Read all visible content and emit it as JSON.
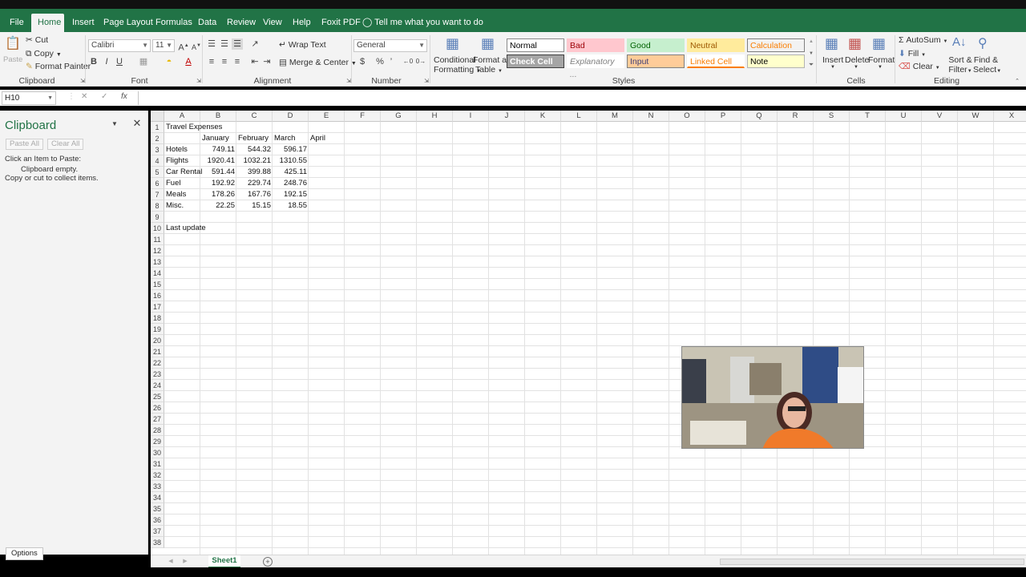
{
  "tabs": [
    "File",
    "Home",
    "Insert",
    "Page Layout",
    "Formulas",
    "Data",
    "Review",
    "View",
    "Help",
    "Foxit PDF"
  ],
  "tell_me": "Tell me what you want to do",
  "ribbon": {
    "clipboard": {
      "paste": "Paste",
      "cut": "Cut",
      "copy": "Copy",
      "format_painter": "Format Painter",
      "label": "Clipboard"
    },
    "font": {
      "name": "Calibri",
      "size": "11",
      "bold": "B",
      "italic": "I",
      "underline": "U",
      "label": "Font"
    },
    "alignment": {
      "wrap": "Wrap Text",
      "merge": "Merge & Center",
      "label": "Alignment"
    },
    "number": {
      "format": "General",
      "currency": "$",
      "percent": "%",
      "comma": "’",
      "label": "Number"
    },
    "conditional": [
      "Conditional",
      "Formatting"
    ],
    "format_table": [
      "Format as",
      "Table"
    ],
    "styles": {
      "label": "Styles",
      "items": [
        {
          "name": "Normal",
          "bg": "#ffffff",
          "fg": "#000000",
          "border": "#8a8a8a"
        },
        {
          "name": "Bad",
          "bg": "#ffc7ce",
          "fg": "#9c0006",
          "border": "#ffc7ce"
        },
        {
          "name": "Good",
          "bg": "#c6efce",
          "fg": "#006100",
          "border": "#c6efce"
        },
        {
          "name": "Neutral",
          "bg": "#ffeb9c",
          "fg": "#9c5700",
          "border": "#ffeb9c"
        },
        {
          "name": "Calculation",
          "bg": "#f2f2f2",
          "fg": "#fa7d00",
          "border": "#7f7f7f"
        },
        {
          "name": "Check Cell",
          "bg": "#a5a5a5",
          "fg": "#ffffff",
          "border": "#3f3f3f"
        },
        {
          "name": "Explanatory ...",
          "bg": "#ffffff",
          "fg": "#7f7f7f",
          "border": "#ffffff"
        },
        {
          "name": "Input",
          "bg": "#ffcc99",
          "fg": "#3f3f76",
          "border": "#7f7f7f"
        },
        {
          "name": "Linked Cell",
          "bg": "#ffffff",
          "fg": "#fa7d00",
          "border": "#ffffff"
        },
        {
          "name": "Note",
          "bg": "#ffffcc",
          "fg": "#000000",
          "border": "#b2b2b2"
        }
      ]
    },
    "cells": {
      "insert": "Insert",
      "delete": "Delete",
      "format": "Format",
      "label": "Cells"
    },
    "editing": {
      "autosum": "AutoSum",
      "fill": "Fill",
      "clear": "Clear",
      "sort": [
        "Sort &",
        "Filter"
      ],
      "find": [
        "Find &",
        "Select"
      ],
      "label": "Editing"
    }
  },
  "formula_bar": {
    "name_box": "H10",
    "fx": "fx",
    "value": ""
  },
  "clipboard_pane": {
    "title": "Clipboard",
    "paste_all": "Paste All",
    "clear_all": "Clear All",
    "instruction": "Click an Item to Paste:",
    "empty": "Clipboard empty.",
    "hint": "Copy or cut to collect items.",
    "options": "Options"
  },
  "columns": [
    "A",
    "B",
    "C",
    "D",
    "E",
    "F",
    "G",
    "H",
    "I",
    "J",
    "K",
    "L",
    "M",
    "N",
    "O",
    "P",
    "Q",
    "R",
    "S",
    "T",
    "U",
    "V",
    "W",
    "X"
  ],
  "rows": [
    "1",
    "2",
    "3",
    "4",
    "5",
    "6",
    "7",
    "8",
    "9",
    "10",
    "11",
    "12",
    "13",
    "14",
    "15",
    "16",
    "17",
    "18",
    "19",
    "20",
    "21",
    "22",
    "23",
    "24",
    "25",
    "26",
    "27",
    "28",
    "29",
    "30",
    "31",
    "32",
    "33",
    "34",
    "35",
    "36",
    "37",
    "38"
  ],
  "sheet": {
    "title": "Travel Expenses",
    "months": [
      "January",
      "February",
      "March",
      "April"
    ],
    "categories": [
      "Hotels",
      "Flights",
      "Car Rental",
      "Fuel",
      "Meals",
      "Misc."
    ],
    "values": [
      [
        "749.11",
        "544.32",
        "596.17"
      ],
      [
        "1920.41",
        "1032.21",
        "1310.55"
      ],
      [
        "591.44",
        "399.88",
        "425.11"
      ],
      [
        "192.92",
        "229.74",
        "248.76"
      ],
      [
        "178.26",
        "167.76",
        "192.15"
      ],
      [
        "22.25",
        "15.15",
        "18.55"
      ]
    ],
    "last_update": "Last update"
  },
  "sheet_tab": "Sheet1",
  "colors": {
    "excel_green": "#217346"
  }
}
